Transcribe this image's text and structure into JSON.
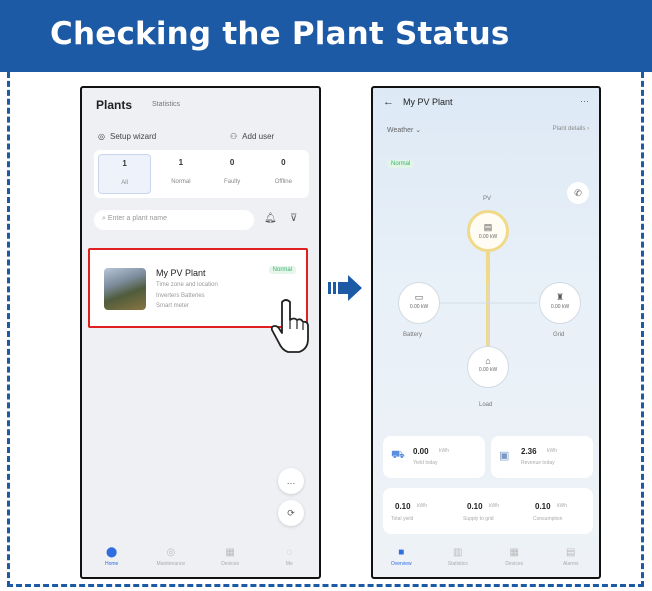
{
  "header": {
    "title": "Checking the Plant Status"
  },
  "colors": {
    "banner": "#1d5aa6",
    "highlight_border": "#e02020",
    "accent": "#2f6de1",
    "status_green": "#3cb371",
    "pv_ring": "#f1d98a"
  },
  "phone1": {
    "title": "Plants",
    "subtitle": "Statistics",
    "actions": [
      {
        "icon": "setup-wizard-icon",
        "label": "Setup wizard"
      },
      {
        "icon": "add-user-icon",
        "label": "Add user"
      }
    ],
    "filters": [
      {
        "count": "1",
        "label": "All"
      },
      {
        "count": "1",
        "label": "Normal"
      },
      {
        "count": "0",
        "label": "Faulty"
      },
      {
        "count": "0",
        "label": "Offline"
      }
    ],
    "search_placeholder": "Enter a plant name",
    "plant_card": {
      "name": "My PV Plant",
      "status": "Normal",
      "meta_line1": "Time zone and location",
      "meta_line2": "Inverters   Batteries",
      "meta_line3": "Smart meter"
    },
    "tabs": [
      "Home",
      "Maintenance",
      "Devices",
      "Me"
    ]
  },
  "phone2": {
    "title": "My PV Plant",
    "weather": "Weather",
    "details": "Plant details",
    "status": "Normal",
    "nodes": {
      "pv": {
        "label": "PV",
        "value": "0.00 kW"
      },
      "battery": {
        "label": "Battery",
        "value": "0.00 kW"
      },
      "grid": {
        "label": "Grid",
        "value": "0.00 kW"
      },
      "load": {
        "label": "Load",
        "value": "0.00 kW"
      }
    },
    "metrics": [
      {
        "value": "0.00",
        "unit": "kWh",
        "label": "Yield today"
      },
      {
        "value": "2.36",
        "unit": "kWh",
        "label": "Revenue today"
      }
    ],
    "totals": [
      {
        "value": "0.10",
        "unit": "kWh",
        "label": "Total yield"
      },
      {
        "value": "0.10",
        "unit": "kWh",
        "label": "Supply to grid"
      },
      {
        "value": "0.10",
        "unit": "kWh",
        "label": "Consumption"
      }
    ],
    "tabs": [
      "Overview",
      "Statistics",
      "Devices",
      "Alarms"
    ]
  }
}
